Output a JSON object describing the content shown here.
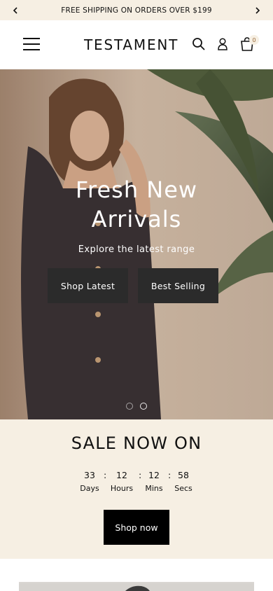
{
  "announcement": {
    "text": "FREE SHIPPING ON ORDERS OVER $199",
    "prev_icon": "chevron-left-icon",
    "next_icon": "chevron-right-icon"
  },
  "header": {
    "logo": "TESTAMENT",
    "menu_icon": "hamburger-icon",
    "search_icon": "search-icon",
    "account_icon": "user-icon",
    "cart_icon": "bag-icon",
    "cart_count": "0"
  },
  "hero": {
    "title_line1": "Fresh New",
    "title_line2": "Arrivals",
    "subtitle": "Explore the latest range",
    "buttons": [
      "Shop Latest",
      "Best Selling"
    ],
    "slide_count": 2,
    "active_slide": 2
  },
  "sale": {
    "heading": "SALE NOW ON",
    "countdown": [
      {
        "value": "33",
        "label": "Days"
      },
      {
        "value": "12",
        "label": "Hours"
      },
      {
        "value": "12",
        "label": "Mins"
      },
      {
        "value": "58",
        "label": "Secs"
      }
    ],
    "separator": ":",
    "button": "Shop now"
  },
  "colors": {
    "cream": "#f6efe3",
    "button_dark": "#2b2b2b",
    "black": "#000000"
  }
}
